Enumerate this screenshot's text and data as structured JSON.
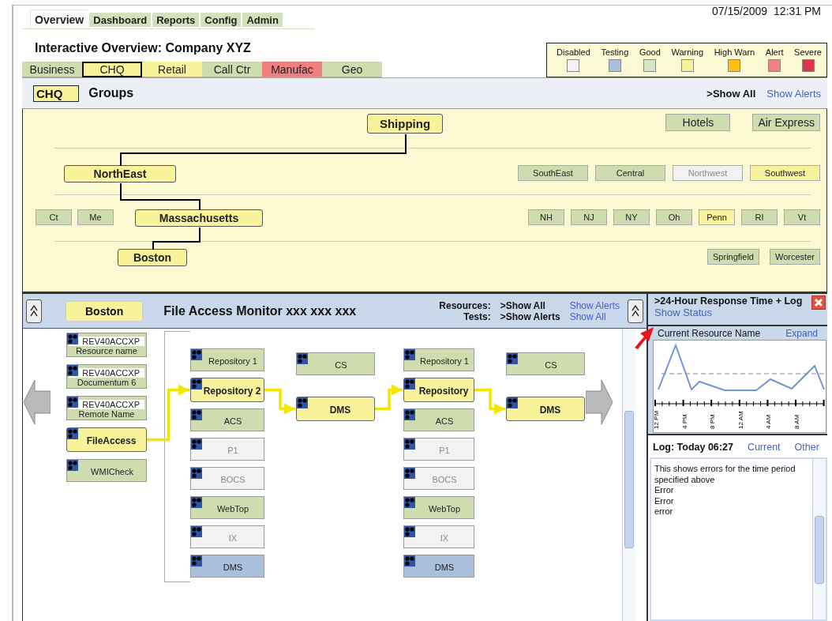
{
  "top_tabs": [
    {
      "label": "Overview",
      "selected": true
    },
    {
      "label": "Dashboard",
      "selected": false
    },
    {
      "label": "Reports",
      "selected": false
    },
    {
      "label": "Config",
      "selected": false
    },
    {
      "label": "Admin",
      "selected": false
    }
  ],
  "date": "07/15/2009",
  "time": "12:31 PM",
  "title": "Interactive Overview: Company XYZ",
  "legend": [
    {
      "label": "Disabled",
      "color": "#f2f2f2"
    },
    {
      "label": "Testing",
      "color": "#a9bfdc"
    },
    {
      "label": "Good",
      "color": "#d4e6c3"
    },
    {
      "label": "Warning",
      "color": "#f7f29c"
    },
    {
      "label": "High Warn",
      "color": "#fdbf12"
    },
    {
      "label": "Alert",
      "color": "#f08484"
    },
    {
      "label": "Severe",
      "color": "#e0344a"
    }
  ],
  "category_tabs": [
    {
      "label": "Business",
      "color": "#cfdcb0",
      "selected": false
    },
    {
      "label": "CHQ",
      "color": "#f8f29b",
      "selected": true
    },
    {
      "label": "Retail",
      "color": "#f8f29b",
      "selected": false
    },
    {
      "label": "Call Ctr",
      "color": "#cfdcb0",
      "selected": false
    },
    {
      "label": "Manufac",
      "color": "#f08080",
      "selected": false
    },
    {
      "label": "Geo",
      "color": "#cfdcb0",
      "selected": false
    }
  ],
  "groups": {
    "badge": "CHQ",
    "title": "Groups",
    "links": [
      {
        "text": ">Show All",
        "kind": "active"
      },
      {
        "text": "Show Alerts",
        "kind": "link"
      }
    ],
    "levels": [
      {
        "nodes": [
          {
            "label": "Shipping",
            "color": "#f8f29b",
            "selected": true,
            "disabled": false
          },
          {
            "label": "Hotels",
            "color": "#cfdcb0",
            "selected": false,
            "disabled": false
          },
          {
            "label": "Air Express",
            "color": "#cfdcb0",
            "selected": false,
            "disabled": false
          }
        ]
      },
      {
        "nodes": [
          {
            "label": "NorthEast",
            "color": "#f8f29b",
            "selected": true,
            "disabled": false
          },
          {
            "label": "SouthEast",
            "color": "#cfdcb0",
            "selected": false,
            "disabled": false
          },
          {
            "label": "Central",
            "color": "#cfdcb0",
            "selected": false,
            "disabled": false
          },
          {
            "label": "Northwest",
            "color": "#f2f2f2",
            "selected": false,
            "disabled": true
          },
          {
            "label": "Southwest",
            "color": "#f8f29b",
            "selected": false,
            "disabled": false
          }
        ]
      },
      {
        "nodes": [
          {
            "label": "Ct",
            "color": "#cfdcb0",
            "selected": false,
            "disabled": false
          },
          {
            "label": "Me",
            "color": "#cfdcb0",
            "selected": false,
            "disabled": false
          },
          {
            "label": "Massachusetts",
            "color": "#f8f29b",
            "selected": true,
            "disabled": false
          },
          {
            "label": "NH",
            "color": "#cfdcb0",
            "selected": false,
            "disabled": false
          },
          {
            "label": "NJ",
            "color": "#cfdcb0",
            "selected": false,
            "disabled": false
          },
          {
            "label": "NY",
            "color": "#cfdcb0",
            "selected": false,
            "disabled": false
          },
          {
            "label": "Oh",
            "color": "#cfdcb0",
            "selected": false,
            "disabled": false
          },
          {
            "label": "Penn",
            "color": "#f8f29b",
            "selected": false,
            "disabled": false
          },
          {
            "label": "RI",
            "color": "#cfdcb0",
            "selected": false,
            "disabled": false
          },
          {
            "label": "Vt",
            "color": "#cfdcb0",
            "selected": false,
            "disabled": false
          }
        ]
      },
      {
        "nodes": [
          {
            "label": "Boston",
            "color": "#f8f29b",
            "selected": true,
            "disabled": false
          },
          {
            "label": "Springfield",
            "color": "#cfdcb0",
            "selected": false,
            "disabled": false
          },
          {
            "label": "Worcester",
            "color": "#cfdcb0",
            "selected": false,
            "disabled": false
          }
        ]
      }
    ]
  },
  "monitor": {
    "location": "Boston",
    "title": "File Access Monitor xxx xxx xxx",
    "filters": [
      {
        "label": "Resources:",
        "links": [
          {
            "text": ">Show All",
            "kind": "active"
          },
          {
            "text": "Show Alerts",
            "kind": "link"
          }
        ]
      },
      {
        "label": "Tests:",
        "links": [
          {
            "text": ">Show Alerts",
            "kind": "active"
          },
          {
            "text": "Show All",
            "kind": "link"
          }
        ]
      }
    ],
    "columns": [
      {
        "nodes": [
          {
            "lines": [
              "REV40ACCXP",
              "Resource name"
            ],
            "color": "#cfdcb0",
            "selected": false,
            "disabled": false
          },
          {
            "lines": [
              "REV40ACCXP",
              "Documentum 6"
            ],
            "color": "#cfdcb0",
            "selected": false,
            "disabled": false
          },
          {
            "lines": [
              "REV40ACCXP",
              "Remote Name"
            ],
            "color": "#cfdcb0",
            "selected": false,
            "disabled": false
          },
          {
            "lines": [
              "FileAccess"
            ],
            "color": "#f8f29b",
            "selected": true,
            "disabled": false
          },
          {
            "lines": [
              "WMICheck"
            ],
            "color": "#cfdcb0",
            "selected": false,
            "disabled": false
          }
        ]
      },
      {
        "nodes": [
          {
            "lines": [
              "Repository 1"
            ],
            "color": "#cfdcb0",
            "selected": false,
            "disabled": false
          },
          {
            "lines": [
              "Repository 2"
            ],
            "color": "#f8f29b",
            "selected": true,
            "disabled": false
          },
          {
            "lines": [
              "ACS"
            ],
            "color": "#cfdcb0",
            "selected": false,
            "disabled": false
          },
          {
            "lines": [
              "P1"
            ],
            "color": "#f2f2f2",
            "selected": false,
            "disabled": true
          },
          {
            "lines": [
              "BOCS"
            ],
            "color": "#f2f2f2",
            "selected": false,
            "disabled": true
          },
          {
            "lines": [
              "WebTop"
            ],
            "color": "#cfdcb0",
            "selected": false,
            "disabled": false
          },
          {
            "lines": [
              "IX"
            ],
            "color": "#f2f2f2",
            "selected": false,
            "disabled": true
          },
          {
            "lines": [
              "DMS"
            ],
            "color": "#a9bfdc",
            "selected": false,
            "disabled": false
          }
        ]
      },
      {
        "nodes": [
          {
            "lines": [
              "CS"
            ],
            "color": "#cfdcb0",
            "selected": false,
            "disabled": false
          },
          {
            "lines": [
              "DMS"
            ],
            "color": "#f8f29b",
            "selected": true,
            "disabled": false
          }
        ]
      },
      {
        "nodes": [
          {
            "lines": [
              "Repository 1"
            ],
            "color": "#cfdcb0",
            "selected": false,
            "disabled": false
          },
          {
            "lines": [
              "Repository"
            ],
            "color": "#f8f29b",
            "selected": true,
            "disabled": false
          },
          {
            "lines": [
              "ACS"
            ],
            "color": "#cfdcb0",
            "selected": false,
            "disabled": false
          },
          {
            "lines": [
              "P1"
            ],
            "color": "#f2f2f2",
            "selected": false,
            "disabled": true
          },
          {
            "lines": [
              "BOCS"
            ],
            "color": "#f2f2f2",
            "selected": false,
            "disabled": true
          },
          {
            "lines": [
              "WebTop"
            ],
            "color": "#cfdcb0",
            "selected": false,
            "disabled": false
          },
          {
            "lines": [
              "IX"
            ],
            "color": "#f2f2f2",
            "selected": false,
            "disabled": true
          },
          {
            "lines": [
              "DMS"
            ],
            "color": "#a9bfdc",
            "selected": false,
            "disabled": false
          }
        ]
      },
      {
        "nodes": [
          {
            "lines": [
              "CS"
            ],
            "color": "#cfdcb0",
            "selected": false,
            "disabled": false
          },
          {
            "lines": [
              "DMS"
            ],
            "color": "#f8f29b",
            "selected": true,
            "disabled": false
          }
        ]
      }
    ]
  },
  "side_panel": {
    "title": ">24-Hour Response Time + Log",
    "link": "Show Status",
    "chart": {
      "title": "Current Resource Name",
      "link": "Expand",
      "x_labels": [
        "12 PM",
        "4 PM",
        "8 PM",
        "12 AM",
        "4 AM",
        "8 AM"
      ]
    },
    "log": {
      "title": "Log: Today 06:27",
      "links": [
        "Current",
        "Other"
      ],
      "lines": [
        "This shows errors for the time period specified above",
        "Error",
        "Error",
        "error"
      ]
    }
  }
}
